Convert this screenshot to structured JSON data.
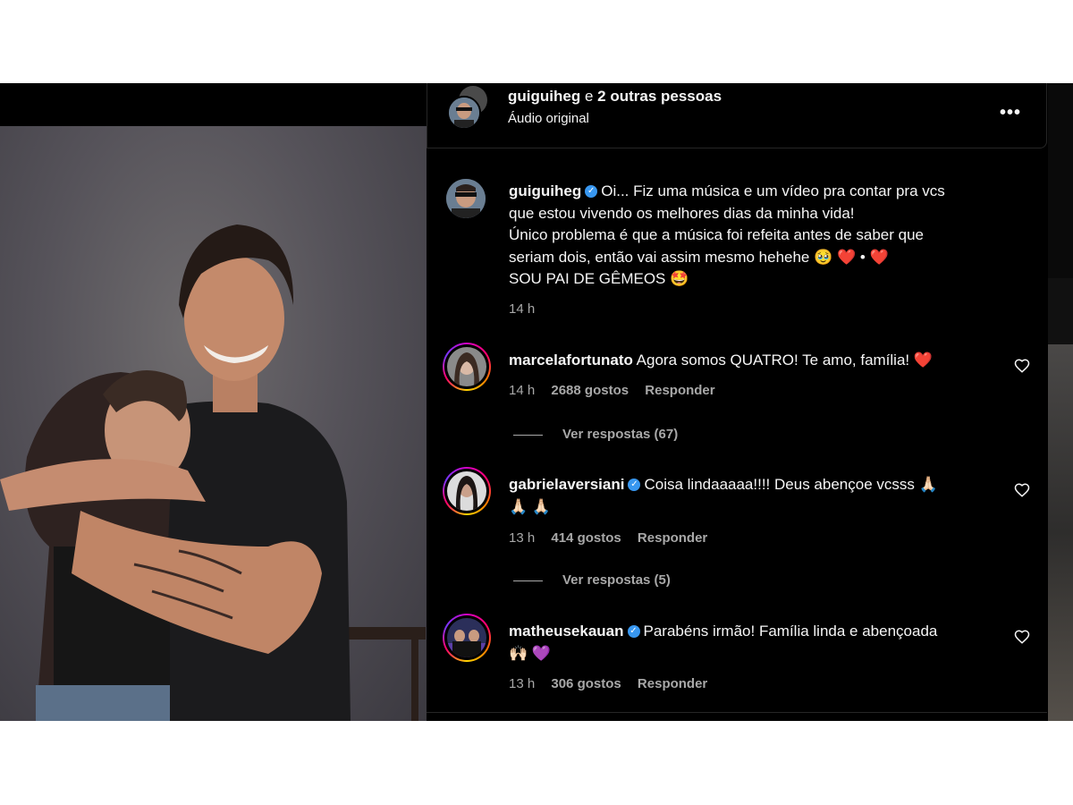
{
  "audio": {
    "user": "guiguiheg",
    "others": "e",
    "others_count": "2 outras pessoas",
    "subtitle": "Áudio original",
    "more_icon": "more-horizontal-icon",
    "more_glyph": "•••"
  },
  "caption": {
    "user": "guiguiheg",
    "line1": "Oi... Fiz uma música e um vídeo pra contar pra vcs",
    "line2": "que estou vivendo os melhores dias da minha vida!",
    "line3": "Único problema é que a música foi refeita antes de saber que",
    "line4": "seriam dois, então vai assim mesmo hehehe 🥹 ❤️ • ❤️",
    "line5": "SOU PAI DE GÊMEOS 🤩",
    "time": "14 h"
  },
  "comments": [
    {
      "user": "marcelafortunato",
      "verified": false,
      "text1": "Agora somos QUATRO! Te amo, família! ❤️",
      "text2": "",
      "time": "14 h",
      "likes": "2688 gostos",
      "reply": "Responder",
      "view_replies": "Ver respostas (67)"
    },
    {
      "user": "gabrielaversiani",
      "verified": true,
      "text1": "Coisa lindaaaaa!!!! Deus abençoe vcsss 🙏🏻",
      "text2": "🙏🏻 🙏🏻",
      "time": "13 h",
      "likes": "414 gostos",
      "reply": "Responder",
      "view_replies": "Ver respostas (5)"
    },
    {
      "user": "matheusekauan",
      "verified": true,
      "text1": "Parabéns irmão! Família linda e abençoada",
      "text2": "🙌🏻 💜",
      "time": "13 h",
      "likes": "306 gostos",
      "reply": "Responder",
      "view_replies": ""
    }
  ],
  "colors": {
    "background": "#000000",
    "text": "#f5f5f5",
    "secondary": "#a8a8a8",
    "verified": "#3897f0"
  }
}
